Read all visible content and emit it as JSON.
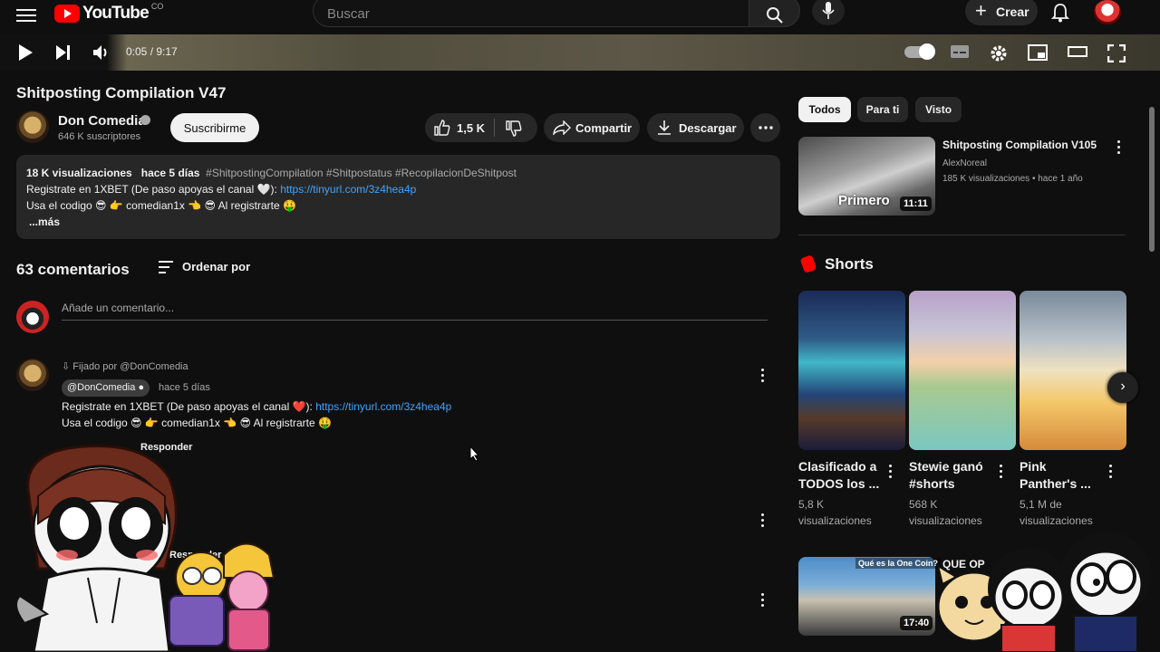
{
  "header": {
    "logo_text": "YouTube",
    "country_code": "CO",
    "search_placeholder": "Buscar",
    "create_label": "Crear"
  },
  "player": {
    "time": "0:05 / 9:17"
  },
  "video": {
    "title": "Shitposting Compilation V47",
    "channel_name": "Don Comedia",
    "subscribers": "646 K suscriptores",
    "subscribe_label": "Suscribirme",
    "likes": "1,5 K",
    "share_label": "Compartir",
    "download_label": "Descargar"
  },
  "description": {
    "views": "18 K visualizaciones",
    "age": "hace 5 días",
    "tags": "#ShitpostingCompilation #Shitpostatus #RecopilacionDeShitpost",
    "line1_text": "Registrate en 1XBET (De paso apoyas el canal 🤍):",
    "line1_link": "https://tinyurl.com/3z4hea4p",
    "line2": "Usa el codigo 😎 👉 comedian1x 👈 😎 Al registrarte 🤑",
    "more": "...más"
  },
  "comments": {
    "count": "63 comentarios",
    "sort_label": "Ordenar por",
    "add_placeholder": "Añade un comentario...",
    "pinned_label": "Fijado por @DonComedia",
    "author": "@DonComedia",
    "time": "hace 5 días",
    "line1_text": "Registrate en 1XBET (De paso apoyas el canal ❤️):",
    "line1_link": "https://tinyurl.com/3z4hea4p",
    "line2": "Usa el codigo 😎 👉 comedian1x 👈 😎 Al registrarte 🤑",
    "reply_label": "Responder",
    "reply_label_2": "Responder"
  },
  "sidebar": {
    "chips": [
      "Todos",
      "Para ti",
      "Visto"
    ],
    "rec1": {
      "title": "Shitposting Compilation V105",
      "channel": "AlexNoreal",
      "meta": "185 K visualizaciones • hace 1 año",
      "duration": "11:11",
      "thumb_text": "Primero"
    },
    "shorts_title": "Shorts",
    "shorts": [
      {
        "title": "Clasificado a TODOS los ...",
        "views": "5,8 K",
        "views_label": "visualizaciones"
      },
      {
        "title": "Stewie ganó #shorts",
        "views": "568 K",
        "views_label": "visualizaciones"
      },
      {
        "title": "Pink Panther's ...",
        "views": "5,1 M de",
        "views_label": "visualizaciones"
      }
    ],
    "rec2": {
      "title": "QUE OP",
      "duration": "17:40",
      "thumb_text": "Qué es la One Coin?"
    }
  }
}
